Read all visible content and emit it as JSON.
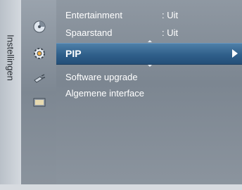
{
  "sidebar": {
    "title": "Instellingen"
  },
  "icons": [
    "disc-icon",
    "gear-icon",
    "plug-icon",
    "tv-input-icon"
  ],
  "menu": {
    "items": [
      {
        "label": "Entertainment",
        "value": ": Uit"
      },
      {
        "label": "Spaarstand",
        "value": ": Uit"
      },
      {
        "label": "PIP",
        "value": "",
        "selected": true
      },
      {
        "label": "Software upgrade",
        "value": ""
      },
      {
        "label": "Algemene interface",
        "value": ""
      }
    ]
  },
  "colors": {
    "highlight": "#2f5f8a",
    "menu_bg": "#7c8691",
    "text": "#ffffff"
  }
}
